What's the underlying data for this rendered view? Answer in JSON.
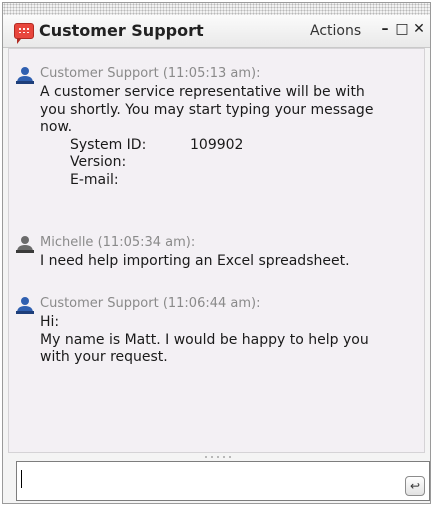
{
  "window": {
    "title": "Customer Support",
    "actions_label": "Actions",
    "minimize_glyph": "–",
    "maximize_glyph": "□",
    "close_glyph": "✕"
  },
  "messages": [
    {
      "sender": "Customer Support",
      "time": "(11:05:13 am):",
      "lines": [
        "A customer service representative will be with",
        "you shortly. You may start typing your message",
        "now."
      ],
      "system_info": [
        {
          "label": "System ID:",
          "value": "109902"
        },
        {
          "label": "Version:",
          "value": ""
        },
        {
          "label": "E-mail:",
          "value": ""
        }
      ]
    },
    {
      "sender": "Michelle",
      "time": "(11:05:34 am):",
      "lines": [
        "I need help importing an Excel spreadsheet."
      ]
    },
    {
      "sender": "Customer Support",
      "time": "(11:06:44 am):",
      "lines": [
        "Hi:",
        "My name is Matt.  I would be happy to help you",
        "with your request."
      ]
    }
  ],
  "input": {
    "value": "",
    "send_glyph": "↩"
  },
  "colors": {
    "agent_icon": "#2f5fb0",
    "user_icon": "#6b6b6b",
    "meta_text": "#8a8a8a",
    "chat_bg": "#f3f0f4"
  }
}
